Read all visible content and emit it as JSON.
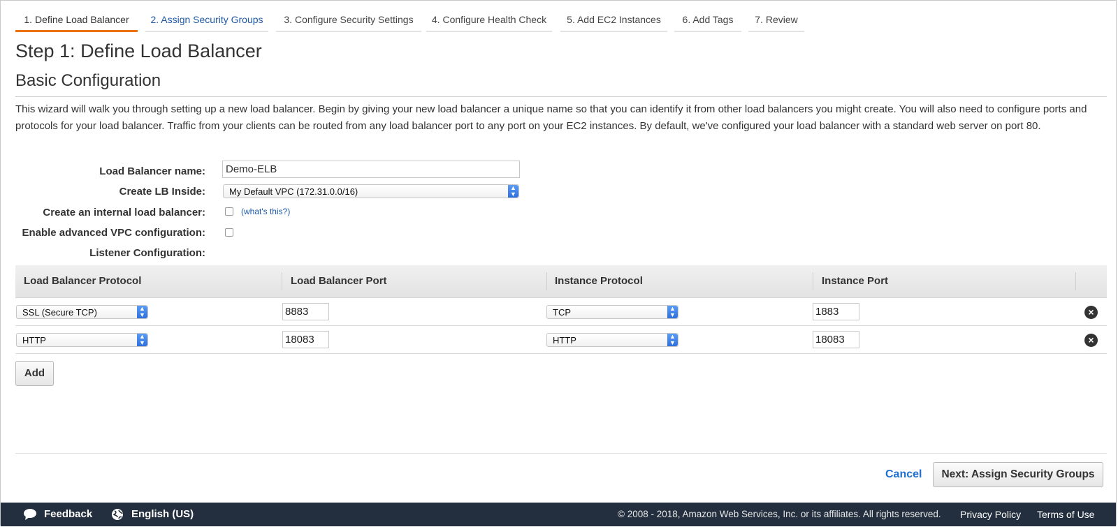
{
  "wizard_tabs": [
    {
      "label": "1. Define Load Balancer",
      "state": "active"
    },
    {
      "label": "2. Assign Security Groups",
      "state": "next"
    },
    {
      "label": "3. Configure Security Settings",
      "state": "pending"
    },
    {
      "label": "4. Configure Health Check",
      "state": "pending"
    },
    {
      "label": "5. Add EC2 Instances",
      "state": "pending"
    },
    {
      "label": "6. Add Tags",
      "state": "pending"
    },
    {
      "label": "7. Review",
      "state": "pending"
    }
  ],
  "page_title": "Step 1: Define Load Balancer",
  "section_title": "Basic Configuration",
  "description": "This wizard will walk you through setting up a new load balancer. Begin by giving your new load balancer a unique name so that you can identify it from other load balancers you might create. You will also need to configure ports and protocols for your load balancer. Traffic from your clients can be routed from any load balancer port to any port on your EC2 instances. By default, we've configured your load balancer with a standard web server on port 80.",
  "form": {
    "name_label": "Load Balancer name:",
    "name_value": "Demo-ELB",
    "inside_label": "Create LB Inside:",
    "inside_value": "My Default VPC (172.31.0.0/16)",
    "internal_label": "Create an internal load balancer:",
    "internal_checked": false,
    "whats_this": "(what's this?)",
    "advanced_label": "Enable advanced VPC configuration:",
    "advanced_checked": false,
    "listener_label": "Listener Configuration:"
  },
  "listener_table": {
    "columns": [
      "Load Balancer Protocol",
      "Load Balancer Port",
      "Instance Protocol",
      "Instance Port"
    ],
    "rows": [
      {
        "lb_protocol": "SSL (Secure TCP)",
        "lb_port": "8883",
        "instance_protocol": "TCP",
        "instance_port": "1883"
      },
      {
        "lb_protocol": "HTTP",
        "lb_port": "18083",
        "instance_protocol": "HTTP",
        "instance_port": "18083"
      }
    ],
    "add_label": "Add"
  },
  "actions": {
    "cancel_label": "Cancel",
    "next_label": "Next: Assign Security Groups"
  },
  "footer": {
    "feedback": "Feedback",
    "language": "English (US)",
    "copyright": "© 2008 - 2018, Amazon Web Services, Inc. or its affiliates. All rights reserved.",
    "privacy": "Privacy Policy",
    "terms": "Terms of Use"
  },
  "colors": {
    "accent_tab": "#ec7211",
    "link": "#1e5aa8",
    "footer_bg": "#232f3e"
  },
  "icons": [
    "feedback-bubble-icon",
    "globe-icon",
    "remove-icon",
    "select-arrows-icon"
  ]
}
